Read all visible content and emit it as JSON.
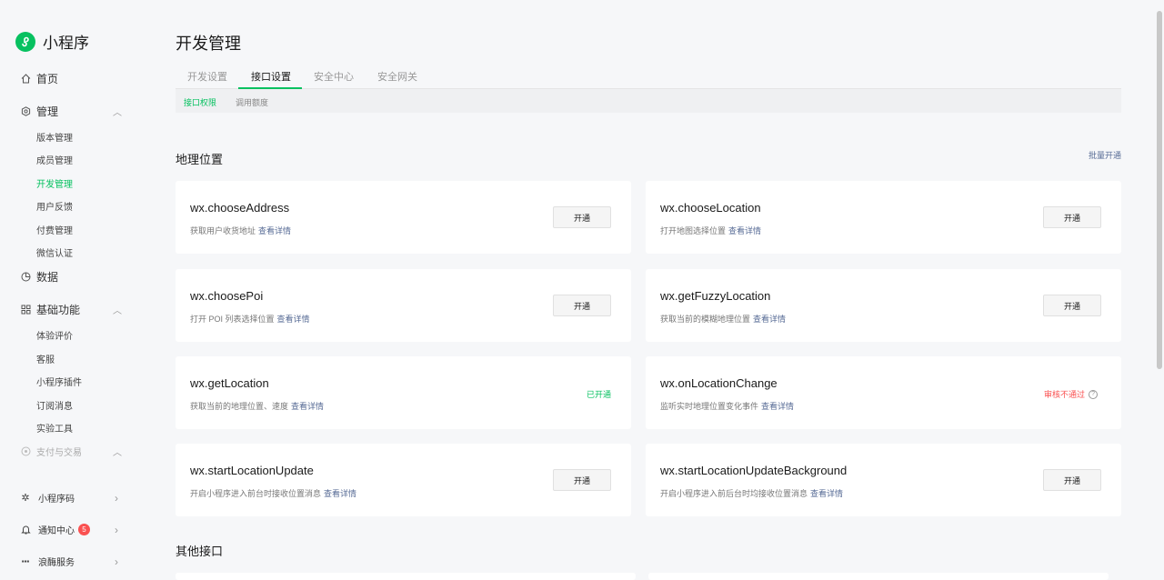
{
  "app": {
    "name": "小程序"
  },
  "sidebar": {
    "home": "首页",
    "manage": "管理",
    "manage_items": [
      "版本管理",
      "成员管理",
      "开发管理",
      "用户反馈",
      "付费管理",
      "微信认证"
    ],
    "data": "数据",
    "basic": "基础功能",
    "basic_items": [
      "体验评价",
      "客服",
      "小程序插件",
      "订阅消息",
      "实验工具"
    ],
    "pay": "支付与交易",
    "bottom": [
      {
        "label": "小程序码"
      },
      {
        "label": "通知中心",
        "badge": "5"
      },
      {
        "label": "浪酶服务"
      }
    ]
  },
  "page": {
    "title": "开发管理",
    "tabs": [
      "开发设置",
      "接口设置",
      "安全中心",
      "安全网关"
    ],
    "subtabs": [
      "接口权限",
      "调用额度"
    ]
  },
  "sections": {
    "location_title": "地理位置",
    "batch_open": "批量开通",
    "other_title": "其他接口"
  },
  "common": {
    "open_btn": "开通",
    "detail": "查看详情",
    "opened": "已开通",
    "rejected": "审核不通过"
  },
  "cards": [
    {
      "name": "wx.chooseAddress",
      "desc": "获取用户收货地址"
    },
    {
      "name": "wx.chooseLocation",
      "desc": "打开地图选择位置"
    },
    {
      "name": "wx.choosePoi",
      "desc": "打开 POI 列表选择位置"
    },
    {
      "name": "wx.getFuzzyLocation",
      "desc": "获取当前的模糊地理位置"
    },
    {
      "name": "wx.getLocation",
      "desc": "获取当前的地理位置、速度"
    },
    {
      "name": "wx.onLocationChange",
      "desc": "监听实时地理位置变化事件"
    },
    {
      "name": "wx.startLocationUpdate",
      "desc": "开启小程序进入前台时接收位置消息"
    },
    {
      "name": "wx.startLocationUpdateBackground",
      "desc": "开启小程序进入前后台时均接收位置消息"
    }
  ],
  "colors": {
    "accent": "#07c160",
    "link": "#576b95",
    "danger": "#fa5151"
  }
}
